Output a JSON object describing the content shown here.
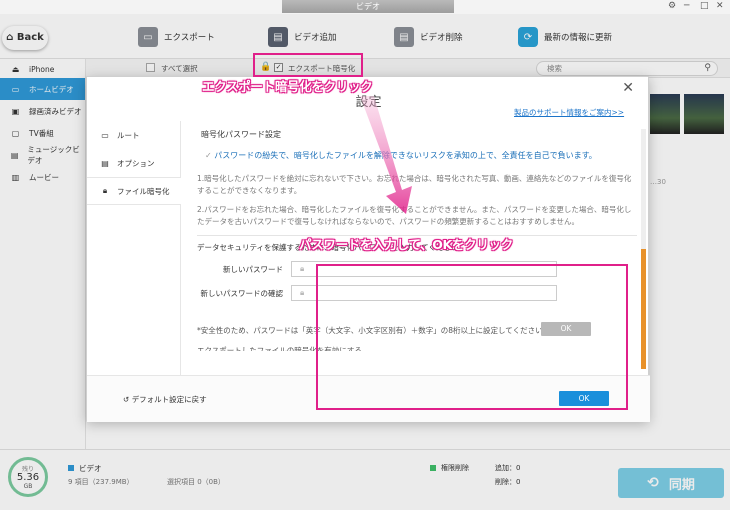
{
  "window": {
    "title": "ビデオ",
    "controls": [
      "⚙",
      "─",
      "□",
      "✕"
    ]
  },
  "toolbar": {
    "back": "Back",
    "export": "エクスポート",
    "add_video": "ビデオ追加",
    "delete_video": "ビデオ削除",
    "refresh": "最新の情報に更新"
  },
  "sidebar": {
    "device": "iPhone",
    "items": [
      "ホームビデオ",
      "録画済みビデオ",
      "TV番組",
      "ミュージックビデオ",
      "ムービー"
    ]
  },
  "filterbar": {
    "select_all": "すべて選択",
    "export_encrypt": "エクスポート暗号化",
    "search_placeholder": "検索"
  },
  "thumb_caption": "…30",
  "dialog": {
    "title": "設定",
    "support_link": "製品のサポート情報をご案内>>",
    "nav": [
      "ルート",
      "オプション",
      "ファイル暗号化"
    ],
    "section_title": "暗号化パスワード設定",
    "warning": "パスワードの紛失で、暗号化したファイルを解除できないリスクを承知の上で、全責任を自己で負います。",
    "para1": "1.暗号化したパスワードを絶対に忘れないで下さい。お忘れた場合は、暗号化された写真、動画、連絡先などのファイルを復号化することができなくなります。",
    "para2": "2.パスワードをお忘れた場合、暗号化したファイルを復号化することができません。また、パスワードを変更した場合、暗号化したデータを古いパスワードで復号しなければならないので、パスワードの頻繁更新することはおすすめしません。",
    "instruction": "データセキュリティを保護するために、暗号化パスワードを入力してください。",
    "new_password_label": "新しいパスワード",
    "confirm_password_label": "新しいパスワードの確認",
    "inner_ok": "OK",
    "note": "*安全性のため、パスワードは「英字（大文字、小文字区別有）＋数字」の8桁以上に設定してください。",
    "partial_line": "エクスポートしたファイルの暗号化を有効にする",
    "restore_default": "デフォルト設定に戻す",
    "ok": "OK"
  },
  "bottombar": {
    "storage_label": "残り",
    "storage_value": "5.36",
    "storage_unit": "GB",
    "category": "ビデオ",
    "item_count": "9 項目（237.9MB）",
    "selected": "選択項目 0（0B）",
    "restricted_delete": "権限削除",
    "added": "追加：0",
    "deleted": "削除：0",
    "sync": "同期"
  },
  "annotations": {
    "top": "エクスポート暗号化をクリック",
    "middle": "パスワードを入力して、OKをクリック"
  },
  "colors": {
    "accent": "#2f9ad8",
    "annotation": "#e0208a",
    "ok_button": "#1a8fdb"
  }
}
